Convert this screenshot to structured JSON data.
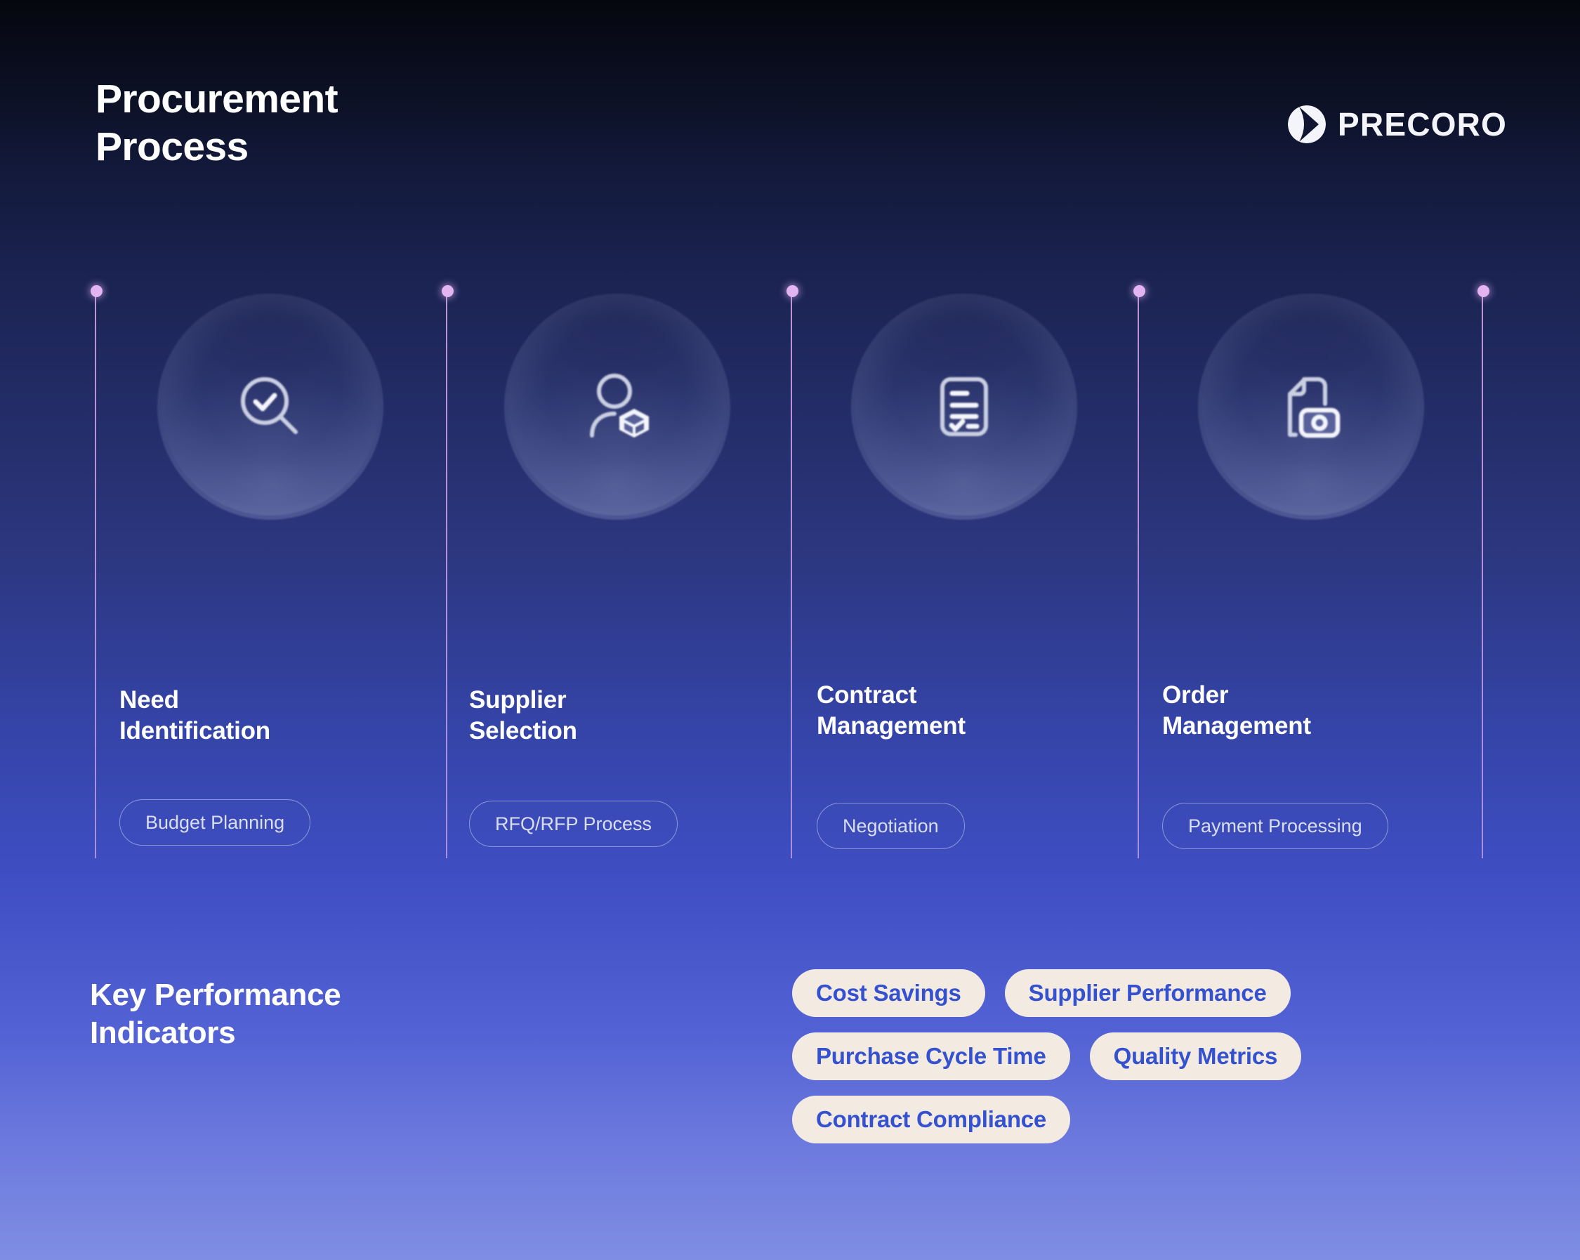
{
  "header": {
    "title": "Procurement\nProcess",
    "logo": {
      "mark": "precoro-play-circle-icon",
      "wordmark": "PRECORO"
    }
  },
  "colors": {
    "background_top": "#05070f",
    "background_bottom": "#7f8ee3",
    "rail": "#d9a9ee",
    "rail_dot": "#e3b4f2",
    "chip_border": "#d7dcf5",
    "kpi_chip_bg": "#f3eae2",
    "kpi_chip_text": "#3451cf",
    "title_text": "#ffffff"
  },
  "steps": [
    {
      "label": "Need\nIdentification",
      "chip": "Budget Planning",
      "icon": "magnifier-check-icon"
    },
    {
      "label": "Supplier\nSelection",
      "chip": "RFQ/RFP Process",
      "icon": "user-box-icon"
    },
    {
      "label": "Contract\nManagement",
      "chip": "Negotiation",
      "icon": "contract-checklist-icon"
    },
    {
      "label": "Order\nManagement",
      "chip": "Payment Processing",
      "icon": "document-payment-icon"
    }
  ],
  "kpi": {
    "title": "Key Performance\nIndicators",
    "items": [
      "Cost Savings",
      "Supplier Performance",
      "Purchase Cycle Time",
      "Quality Metrics",
      "Contract Compliance"
    ]
  }
}
